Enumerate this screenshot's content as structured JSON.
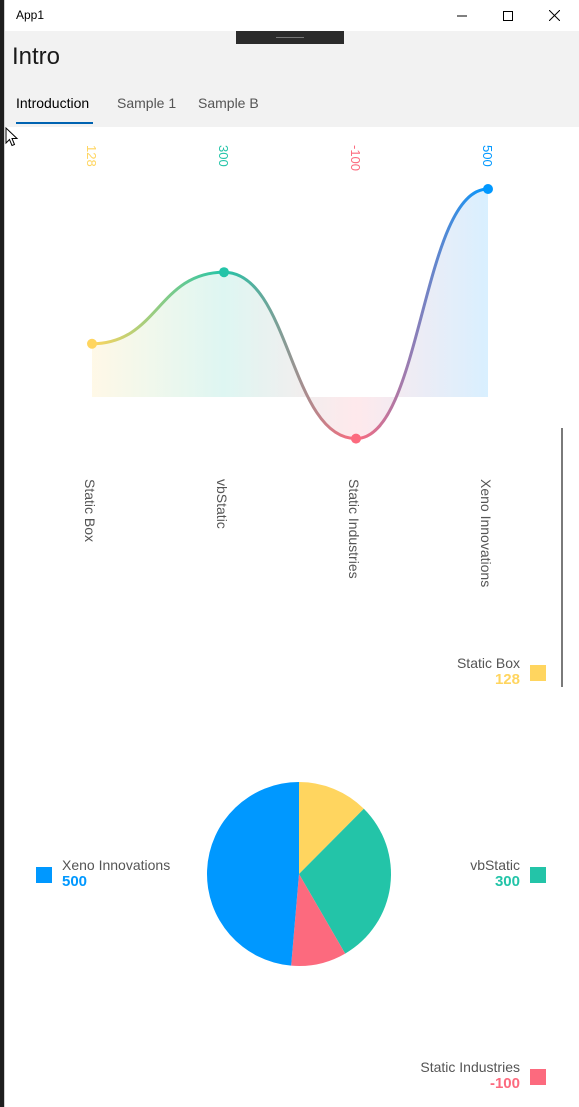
{
  "window": {
    "title": "App1"
  },
  "page": {
    "title": "Intro"
  },
  "tabs": [
    {
      "label": "Introduction",
      "active": true
    },
    {
      "label": "Sample 1",
      "active": false
    },
    {
      "label": "Sample B",
      "active": false
    }
  ],
  "chart_data": [
    {
      "type": "area",
      "categories": [
        "Static Box",
        "vbStatic",
        "Static Industries",
        "Xeno Innovations"
      ],
      "values": [
        128,
        300,
        -100,
        500
      ],
      "value_labels": [
        "128",
        "300",
        "-100",
        "500"
      ],
      "colors": [
        "#ffd55f",
        "#23c4a8",
        "#fc6a7e",
        "#0098ff"
      ],
      "smoothed": true,
      "grid": false
    },
    {
      "type": "pie",
      "categories": [
        "Static Box",
        "vbStatic",
        "Static Industries",
        "Xeno Innovations"
      ],
      "values": [
        128,
        300,
        -100,
        500
      ],
      "value_labels": [
        "128",
        "300",
        "-100",
        "500"
      ],
      "colors": [
        "#ffd55f",
        "#23c4a8",
        "#fc6a7e",
        "#0098ff"
      ],
      "legend": "around"
    }
  ],
  "icons": {
    "minimize": "minimize-icon",
    "maximize": "maximize-icon",
    "close": "close-icon",
    "cursor": "mouse-cursor-icon"
  }
}
